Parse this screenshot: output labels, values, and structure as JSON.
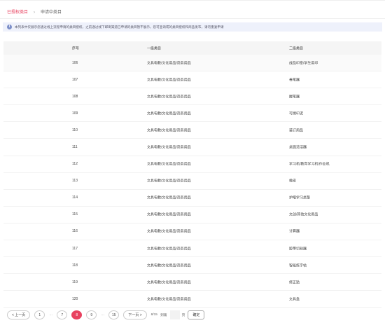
{
  "tabs": {
    "authorized": "已授权类目",
    "applying": "申请中类目"
  },
  "notice": {
    "text": "本列表中仅展示您通过线上流程申请的类目授权，之前通过线下邮寄渠道已申请的类目暂不展示，您可查询或的类目授权和商品发布，请勿重复申请"
  },
  "table": {
    "headers": [
      "序号",
      "一级类目",
      "二级类目"
    ],
    "rows": [
      {
        "id": "106",
        "cat1": "文具电教/文化用品/商务用品",
        "cat2": "成品印章/学生用印"
      },
      {
        "id": "107",
        "cat1": "文具电教/文化用品/商务用品",
        "cat2": "卷笔器"
      },
      {
        "id": "108",
        "cat1": "文具电教/文化用品/商务用品",
        "cat2": "握笔器"
      },
      {
        "id": "109",
        "cat1": "文具电教/文化用品/商务用品",
        "cat2": "可擦印泥"
      },
      {
        "id": "110",
        "cat1": "文具电教/文化用品/商务用品",
        "cat2": "装订用品"
      },
      {
        "id": "111",
        "cat1": "文具电教/文化用品/商务用品",
        "cat2": "桌面清洁器"
      },
      {
        "id": "112",
        "cat1": "文具电教/文化用品/商务用品",
        "cat2": "学习机/教育学习机/作业机"
      },
      {
        "id": "113",
        "cat1": "文具电教/文化用品/商务用品",
        "cat2": "橡皮"
      },
      {
        "id": "114",
        "cat1": "文具电教/文化用品/商务用品",
        "cat2": "护眼学习桌垫"
      },
      {
        "id": "115",
        "cat1": "文具电教/文化用品/商务用品",
        "cat2": "文创/其他文化用品"
      },
      {
        "id": "116",
        "cat1": "文具电教/文化用品/商务用品",
        "cat2": "计算器"
      },
      {
        "id": "117",
        "cat1": "文具电教/文化用品/商务用品",
        "cat2": "胶带切割器"
      },
      {
        "id": "118",
        "cat1": "文具电教/文化用品/商务用品",
        "cat2": "智能练字帖"
      },
      {
        "id": "119",
        "cat1": "文具电教/文化用品/商务用品",
        "cat2": "修正贴"
      },
      {
        "id": "120",
        "cat1": "文具电教/文化用品/商务用品",
        "cat2": "文具盒"
      }
    ]
  },
  "pagination": {
    "prev": "< 上一页",
    "pages": [
      "1",
      "7",
      "8",
      "9",
      "15"
    ],
    "current": "8",
    "ellipsis": "···",
    "next": "下一页 >",
    "info": "8/15",
    "goto_label": "到第",
    "page_unit": "页",
    "confirm": "确定"
  },
  "colors": {
    "accent": "#e8415f",
    "notice_bg": "#eef1fb",
    "info_icon": "#7d8fc9"
  }
}
